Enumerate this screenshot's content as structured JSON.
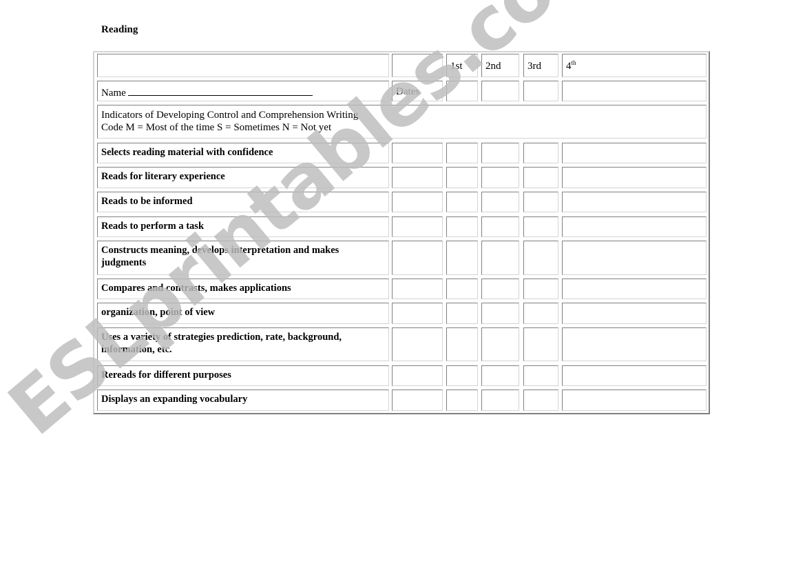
{
  "document": {
    "title": "Reading",
    "header_row": {
      "col1": "",
      "col2": "",
      "periods": [
        {
          "label": "1st",
          "sup": ""
        },
        {
          "label": "2nd",
          "sup": ""
        },
        {
          "label": "3rd",
          "sup": ""
        },
        {
          "label": "4",
          "sup": "th"
        }
      ]
    },
    "name_row": {
      "name_label": "Name",
      "dates_label": "Dates"
    },
    "indicators": {
      "line1": "Indicators of Developing Control and Comprehension Writing",
      "line2": "Code M = Most of the time S = Sometimes N = Not yet"
    },
    "criteria": [
      "Selects reading material with confidence",
      "Reads for literary experience",
      "Reads to be informed",
      "Reads to perform a task",
      "Constructs meaning, develops interpretation and makes judgments",
      "Compares and contrasts, makes applications",
      "organization, point of view",
      "Uses a variety of strategies prediction, rate, background, information, etc.",
      "Rereads for different purposes",
      "Displays an expanding vocabulary"
    ],
    "watermark": "ESLprintables.com"
  }
}
